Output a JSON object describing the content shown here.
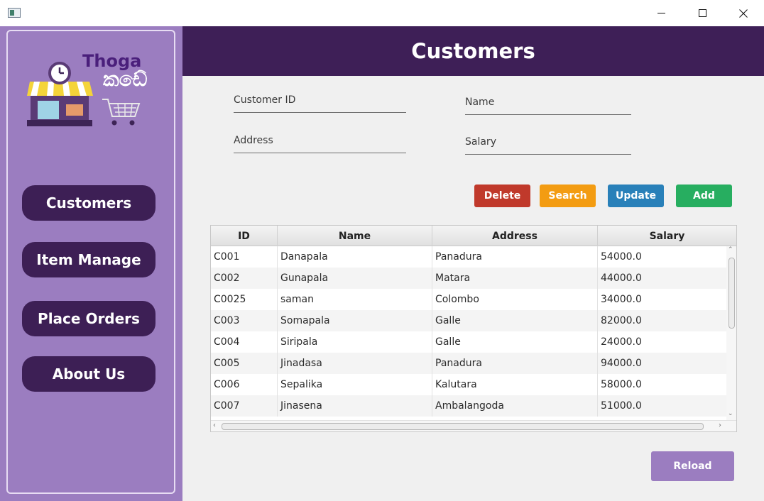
{
  "window": {
    "app_icon": "java-app-icon",
    "controls": [
      "minimize-icon",
      "maximize-icon",
      "close-icon"
    ]
  },
  "logo": {
    "line1": "Thoga",
    "line2": "කඩේ",
    "icons": [
      "shop-icon",
      "clock-icon",
      "cart-icon"
    ]
  },
  "nav": {
    "customers": "Customers",
    "item_manage": "Item Manage",
    "place_orders": "Place Orders",
    "about_us": "About Us"
  },
  "header": {
    "title": "Customers"
  },
  "form": {
    "customer_id": {
      "placeholder": "Customer ID",
      "value": ""
    },
    "name": {
      "placeholder": "Name",
      "value": ""
    },
    "address": {
      "placeholder": "Address",
      "value": ""
    },
    "salary": {
      "placeholder": "Salary",
      "value": ""
    }
  },
  "actions": {
    "delete": "Delete",
    "search": "Search",
    "update": "Update",
    "add": "Add",
    "reload": "Reload"
  },
  "colors": {
    "sidebar": "#9b7dc0",
    "header": "#3e1f57",
    "nav_button": "#3d1f55",
    "delete": "#c0392b",
    "search": "#f39c12",
    "update": "#2980b9",
    "add": "#27ae60",
    "reload": "#9b7dc0"
  },
  "table": {
    "columns": [
      "ID",
      "Name",
      "Address",
      "Salary"
    ],
    "rows": [
      [
        "C001",
        "Danapala",
        "Panadura",
        "54000.0"
      ],
      [
        "C002",
        "Gunapala",
        "Matara",
        "44000.0"
      ],
      [
        "C0025",
        "saman",
        "Colombo",
        "34000.0"
      ],
      [
        "C003",
        "Somapala",
        "Galle",
        "82000.0"
      ],
      [
        "C004",
        "Siripala",
        "Galle",
        "24000.0"
      ],
      [
        "C005",
        "Jinadasa",
        "Panadura",
        "94000.0"
      ],
      [
        "C006",
        "Sepalika",
        "Kalutara",
        "58000.0"
      ],
      [
        "C007",
        "Jinasena",
        "Ambalangoda",
        "51000.0"
      ]
    ]
  }
}
